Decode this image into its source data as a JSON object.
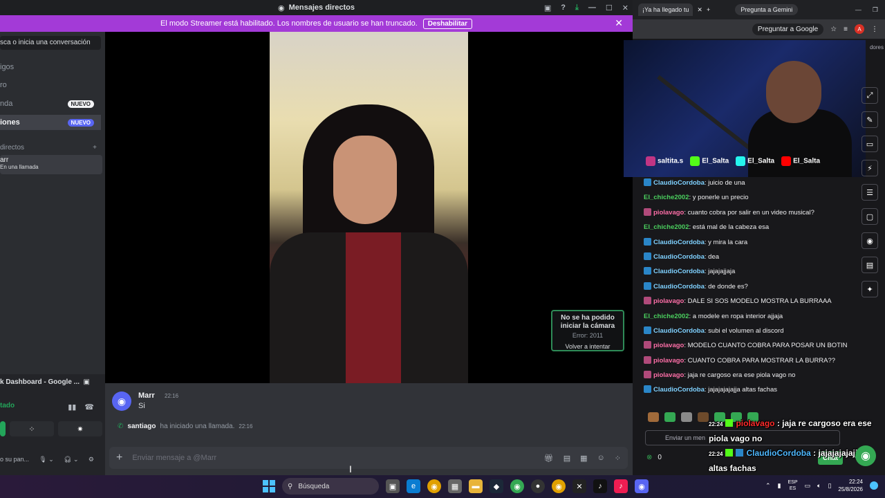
{
  "discord": {
    "window_title": "Mensajes directos",
    "streamer_banner": {
      "text": "El modo Streamer está habilitado. Los nombres de usuario se han truncado.",
      "button": "Deshabilitar"
    },
    "search_placeholder": "sca o inicia una conversación",
    "sidebar_items": [
      {
        "label": "igos"
      },
      {
        "label": "ro"
      },
      {
        "label": "nda",
        "badge": "NUEVO"
      },
      {
        "label": "iones",
        "badge": "NUEVO"
      }
    ],
    "dm_header": "directos",
    "dm_user": {
      "name": "arr",
      "status": "En una llamada"
    },
    "panel": {
      "activity": "k Dashboard - Google ...",
      "connection": "tado",
      "user_status": "o su pan..."
    },
    "camera_error": {
      "line1": "No se ha podido",
      "line2": "iniciar la cámara",
      "code": "Error: 2011",
      "retry": "Volver a intentar"
    },
    "message": {
      "author": "Marr",
      "time": "22:16",
      "text": "Si"
    },
    "call_notice": {
      "user": "santiago",
      "text": "ha iniciado una llamada.",
      "time": "22:16"
    },
    "composer_placeholder": "Enviar mensaje a @Marr"
  },
  "browser": {
    "tab_title": "¡Ya ha llegado tu",
    "gemini_label": "Pregunta a Gemini",
    "ask_google": "Preguntar a Google",
    "avatar_letter": "A",
    "partial_text": "dores"
  },
  "stream": {
    "socials": [
      {
        "handle": "saltita.s",
        "color": "#c13584"
      },
      {
        "handle": "El_Salta",
        "color": "#53fc18"
      },
      {
        "handle": "El_Salta",
        "color": "#25f4ee"
      },
      {
        "handle": "El_Salta",
        "color": "#ff0000"
      }
    ]
  },
  "chat": {
    "messages": [
      {
        "user": "ClaudioCordoba",
        "color": "#7fd1ff",
        "badge": "#2a86c8",
        "text": ": juicio de una"
      },
      {
        "user": "El_chiche2002",
        "color": "#4bd15f",
        "badge": null,
        "text": ": y ponerle un precio"
      },
      {
        "user": "piolavago",
        "color": "#ff6fa8",
        "badge": "#b04a7a",
        "text": ": cuanto cobra por salir en un video musical?"
      },
      {
        "user": "El_chiche2002",
        "color": "#4bd15f",
        "badge": null,
        "text": ": está mal de la cabeza esa"
      },
      {
        "user": "ClaudioCordoba",
        "color": "#7fd1ff",
        "badge": "#2a86c8",
        "text": ": y mira la cara"
      },
      {
        "user": "ClaudioCordoba",
        "color": "#7fd1ff",
        "badge": "#2a86c8",
        "text": ": dea"
      },
      {
        "user": "ClaudioCordoba",
        "color": "#7fd1ff",
        "badge": "#2a86c8",
        "text": ": jajajajjaja"
      },
      {
        "user": "ClaudioCordoba",
        "color": "#7fd1ff",
        "badge": "#2a86c8",
        "text": ": de donde es?"
      },
      {
        "user": "piolavago",
        "color": "#ff6fa8",
        "badge": "#b04a7a",
        "text": ": DALE SI SOS MODELO MOSTRA LA BURRAAA"
      },
      {
        "user": "El_chiche2002",
        "color": "#4bd15f",
        "badge": null,
        "text": ": a modele en ropa interior ajjaja"
      },
      {
        "user": "ClaudioCordoba",
        "color": "#7fd1ff",
        "badge": "#2a86c8",
        "text": ": subi el volumen al discord"
      },
      {
        "user": "piolavago",
        "color": "#ff6fa8",
        "badge": "#b04a7a",
        "text": ": MODELO CUANTO COBRA PARA POSAR UN BOTIN"
      },
      {
        "user": "piolavago",
        "color": "#ff6fa8",
        "badge": "#b04a7a",
        "text": ": CUANTO COBRA PARA MOSTRAR LA BURRA??"
      },
      {
        "user": "piolavago",
        "color": "#ff6fa8",
        "badge": "#b04a7a",
        "text": ": jaja re cargoso era ese piola vago no"
      },
      {
        "user": "ClaudioCordoba",
        "color": "#7fd1ff",
        "badge": "#2a86c8",
        "text": ": jajajajajajja altas fachas"
      }
    ],
    "input_placeholder": "Enviar un men",
    "points": "0",
    "chat_button": "Chat"
  },
  "overlay": [
    {
      "time": "22:24",
      "user": "piolavago",
      "color": "#ff2b2b",
      "text": " : jaja re cargoso era ese",
      "text2": "piola vago no"
    },
    {
      "time": "22:24",
      "user": "ClaudioCordoba",
      "color": "#4fb8ff",
      "text": " : jajajajajajja",
      "text2": "altas fachas"
    }
  ],
  "taskbar": {
    "search_label": "Búsqueda",
    "lang_line1": "ESP",
    "lang_line2": "ES",
    "time": "22:24",
    "date": "25/8/2026"
  }
}
